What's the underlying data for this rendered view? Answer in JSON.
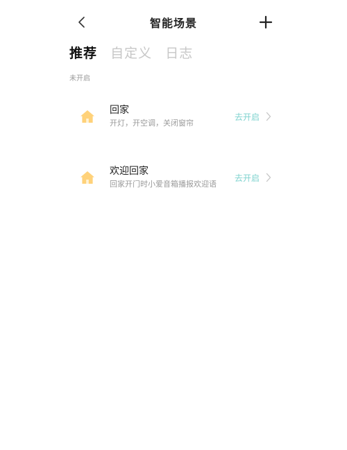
{
  "header": {
    "title": "智能场景",
    "back_icon": "chevron-left-icon",
    "add_icon": "plus-icon"
  },
  "tabs": [
    {
      "label": "推荐",
      "active": true
    },
    {
      "label": "自定义",
      "active": false
    },
    {
      "label": "日志",
      "active": false
    }
  ],
  "section": {
    "label": "未开启"
  },
  "scenes": [
    {
      "icon": "house-icon",
      "title": "回家",
      "description": "开灯，开空调，关闭窗帘",
      "action": "去开启"
    },
    {
      "icon": "house-icon",
      "title": "欢迎回家",
      "description": "回家开门时小爱音箱播报欢迎语",
      "action": "去开启"
    }
  ],
  "colors": {
    "accent": "#7fd3cf",
    "house_icon": "#ffd27a",
    "text_primary": "#222222",
    "text_secondary": "#9a9a9a",
    "tab_inactive": "#c7c7c7"
  }
}
